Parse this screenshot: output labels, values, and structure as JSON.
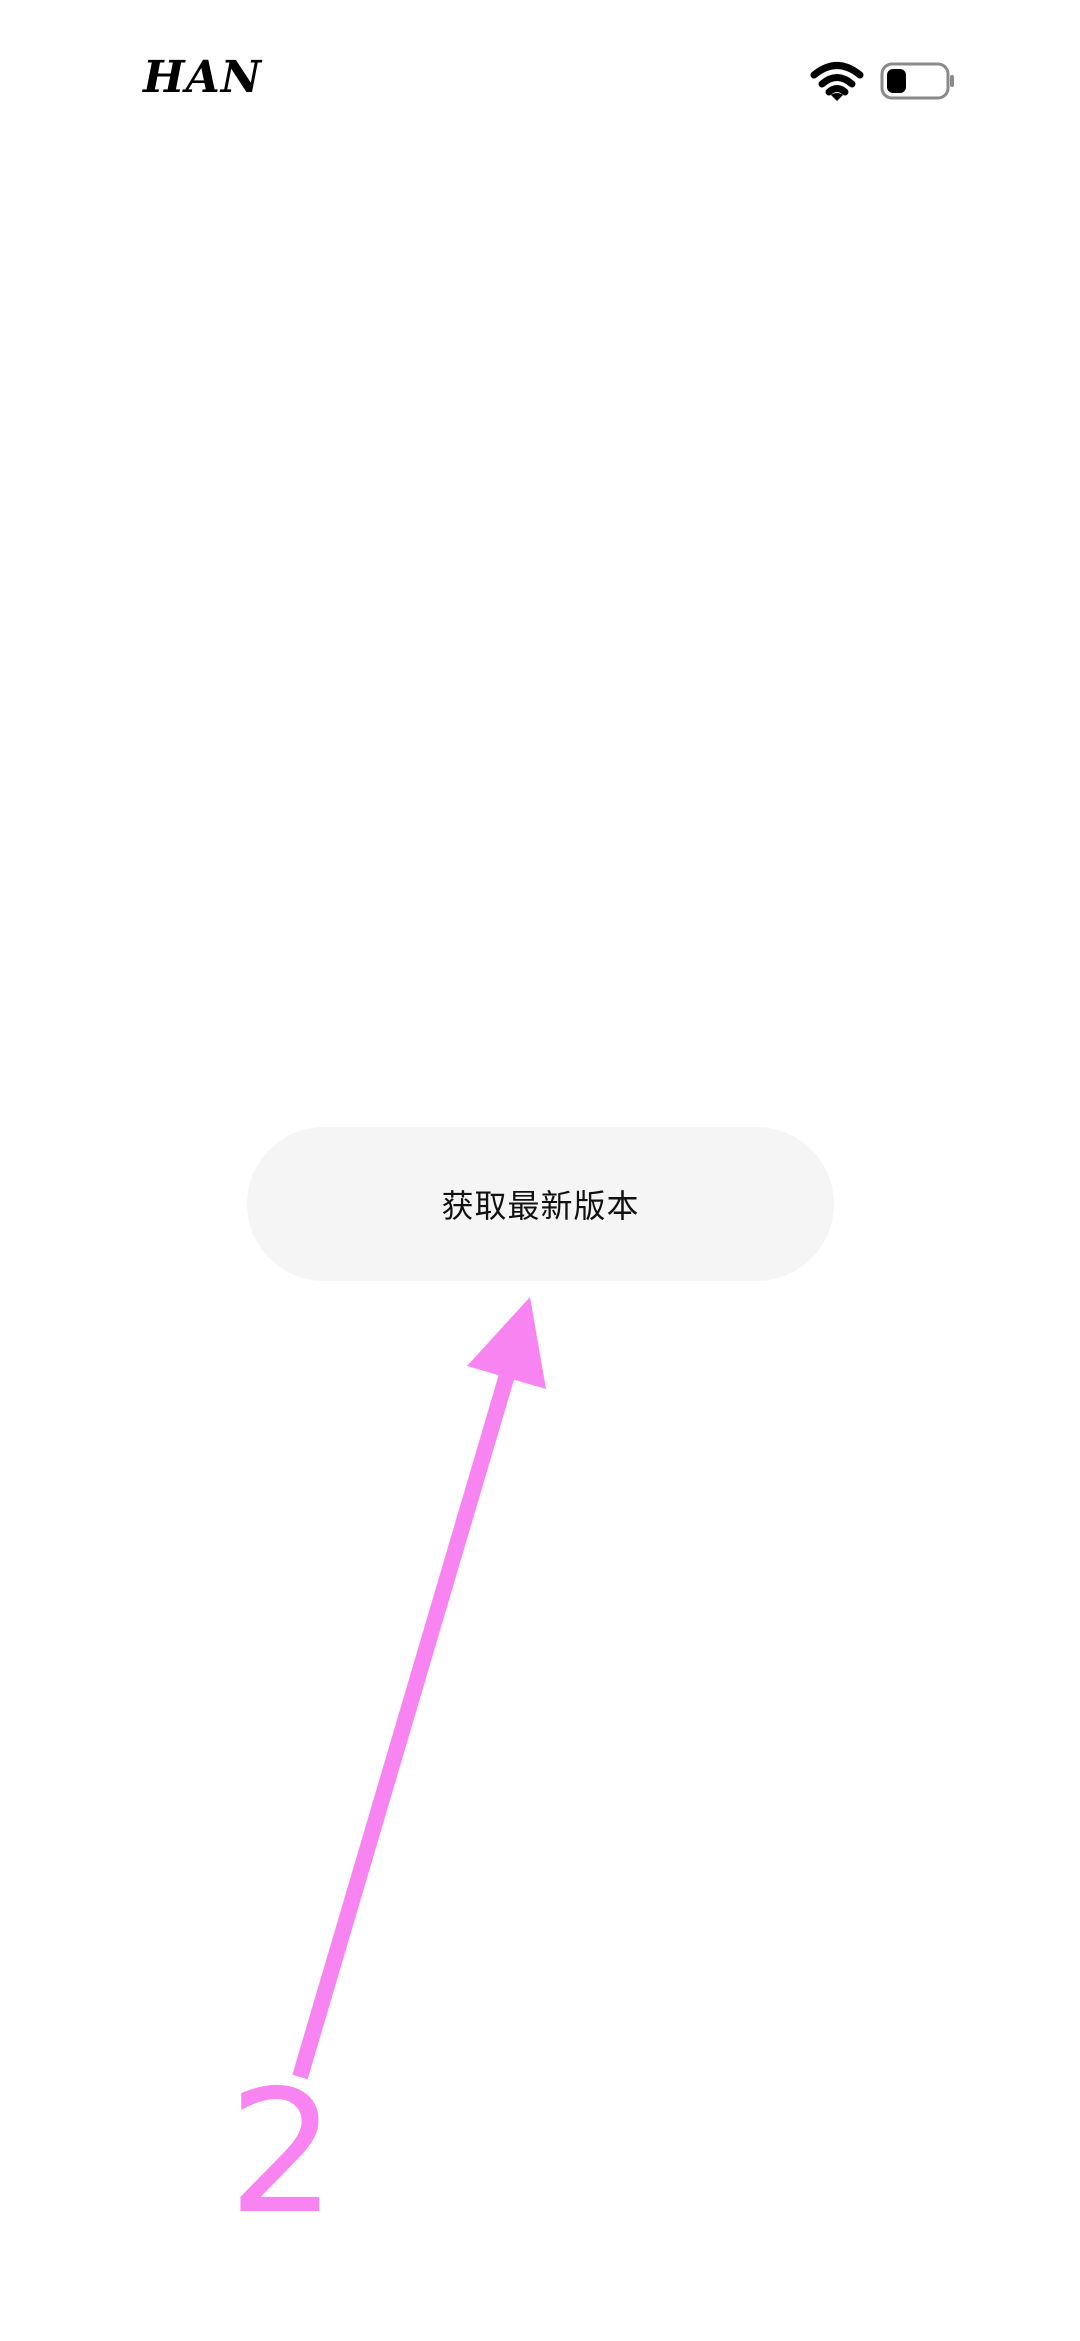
{
  "status_bar": {
    "carrier": "HAN",
    "wifi_icon": "wifi-icon",
    "battery_icon": "battery-icon"
  },
  "main": {
    "update_button_label": "获取最新版本"
  },
  "annotation": {
    "step_number": "2",
    "color": "#f884f2",
    "icon": "arrow-icon"
  },
  "colors": {
    "background": "#ffffff",
    "button_background": "#f5f5f5",
    "text": "#111111",
    "annotation": "#f884f2"
  }
}
